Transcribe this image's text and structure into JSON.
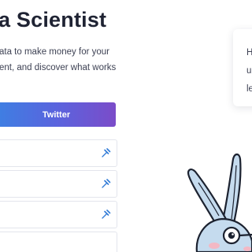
{
  "hero": {
    "title": "a Scientist",
    "tagline_lines": [
      "ata to make money for your",
      "ent, and discover what works"
    ]
  },
  "signup": {
    "twitter_label": "Twitter",
    "fields": [
      {
        "value": "",
        "icon": "pin-icon"
      },
      {
        "value": "",
        "icon": "pin-icon"
      },
      {
        "value": "",
        "icon": "pin-icon"
      },
      {
        "value": "",
        "icon": "none"
      }
    ]
  },
  "side_card": {
    "lines": [
      "H",
      "u",
      "le"
    ]
  },
  "colors": {
    "title": "#1f2333",
    "body_text": "#3e4254",
    "button_gradient_start": "#3e7fe2",
    "button_gradient_end": "#7b4cc9",
    "field_border": "#e3e5ec",
    "pin_icon": "#2f7ad6",
    "mascot_fill": "#c5dbee",
    "mascot_outline": "#1c2230"
  }
}
